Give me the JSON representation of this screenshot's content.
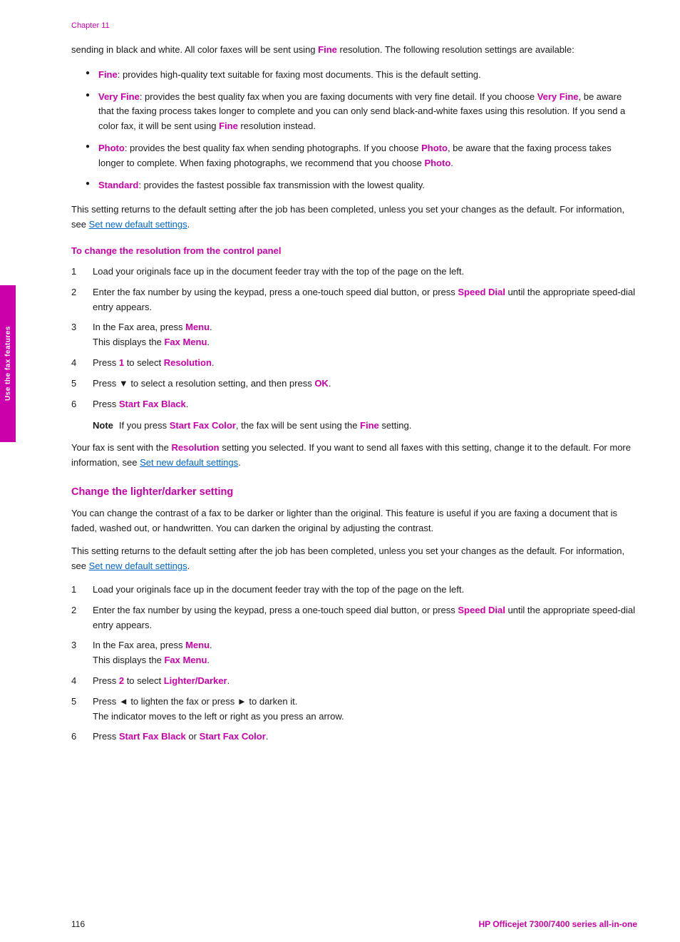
{
  "chapter": "Chapter 11",
  "sidebar_label": "Use the fax features",
  "intro": {
    "para1": "sending in black and white. All color faxes will be sent using ",
    "fine1": "Fine",
    "para1b": " resolution. The following resolution settings are available:"
  },
  "bullets": [
    {
      "keyword": "Fine",
      "text": ": provides high-quality text suitable for faxing most documents. This is the default setting."
    },
    {
      "keyword": "Very Fine",
      "text": ": provides the best quality fax when you are faxing documents with very fine detail. If you choose ",
      "keyword2": "Very Fine",
      "text2": ", be aware that the faxing process takes longer to complete and you can only send black-and-white faxes using this resolution. If you send a color fax, it will be sent using ",
      "keyword3": "Fine",
      "text3": " resolution instead."
    },
    {
      "keyword": "Photo",
      "text": ": provides the best quality fax when sending photographs. If you choose ",
      "keyword2": "Photo",
      "text2": ", be aware that the faxing process takes longer to complete. When faxing photographs, we recommend that you choose ",
      "keyword3": "Photo",
      "text3": "."
    },
    {
      "keyword": "Standard",
      "text": ": provides the fastest possible fax transmission with the lowest quality."
    }
  ],
  "setting_returns_para": "This setting returns to the default setting after the job has been completed, unless you set your changes as the default. For information, see ",
  "set_new_default_link": "Set new default settings",
  "setting_returns_para2": ".",
  "section1_heading": "To change the resolution from the control panel",
  "steps1": [
    {
      "num": "1",
      "text": "Load your originals face up in the document feeder tray with the top of the page on the left."
    },
    {
      "num": "2",
      "text": "Enter the fax number by using the keypad, press a one-touch speed dial button, or press ",
      "keyword": "Speed Dial",
      "text2": " until the appropriate speed-dial entry appears."
    },
    {
      "num": "3",
      "text": "In the Fax area, press ",
      "keyword": "Menu",
      "text2": ".",
      "sub": "This displays the ",
      "sub_keyword": "Fax Menu",
      "sub2": "."
    },
    {
      "num": "4",
      "text": "Press ",
      "keyword": "1",
      "text2": " to select ",
      "keyword2": "Resolution",
      "text3": "."
    },
    {
      "num": "5",
      "text": "Press ▼ to select a resolution setting, and then press ",
      "keyword": "OK",
      "text2": "."
    },
    {
      "num": "6",
      "text": "Press ",
      "keyword": "Start Fax Black",
      "text2": "."
    }
  ],
  "note_label": "Note",
  "note_text": "If you press ",
  "note_keyword1": "Start Fax Color",
  "note_text2": ", the fax will be sent using the ",
  "note_keyword2": "Fine",
  "note_text3": " setting.",
  "result_para1": "Your fax is sent with the ",
  "result_keyword1": "Resolution",
  "result_para2": " setting you selected. If you want to send all faxes with this setting, change it to the default. For more information, see ",
  "result_link": "Set new default settings",
  "result_para3": ".",
  "main_section2_heading": "Change the lighter/darker setting",
  "section2_para1": "You can change the contrast of a fax to be darker or lighter than the original. This feature is useful if you are faxing a document that is faded, washed out, or handwritten. You can darken the original by adjusting the contrast.",
  "section2_para2_prefix": "This setting returns to the default setting after the job has been completed, unless you set your changes as the default. For information, see ",
  "section2_link": "Set new default settings",
  "section2_para2_suffix": ".",
  "steps2": [
    {
      "num": "1",
      "text": "Load your originals face up in the document feeder tray with the top of the page on the left."
    },
    {
      "num": "2",
      "text": "Enter the fax number by using the keypad, press a one-touch speed dial button, or press ",
      "keyword": "Speed Dial",
      "text2": " until the appropriate speed-dial entry appears."
    },
    {
      "num": "3",
      "text": "In the Fax area, press ",
      "keyword": "Menu",
      "text2": ".",
      "sub": "This displays the ",
      "sub_keyword": "Fax Menu",
      "sub2": "."
    },
    {
      "num": "4",
      "text": "Press ",
      "keyword": "2",
      "text2": " to select ",
      "keyword2": "Lighter/Darker",
      "text3": "."
    },
    {
      "num": "5",
      "text_pre": "Press ◄ to lighten the fax or press ► to darken it.",
      "sub": "The indicator moves to the left or right as you press an arrow."
    },
    {
      "num": "6",
      "text": "Press ",
      "keyword": "Start Fax Black",
      "text2": " or ",
      "keyword2": "Start Fax Color",
      "text3": "."
    }
  ],
  "footer": {
    "page": "116",
    "product": "HP Officejet 7300/7400 series all-in-one"
  }
}
